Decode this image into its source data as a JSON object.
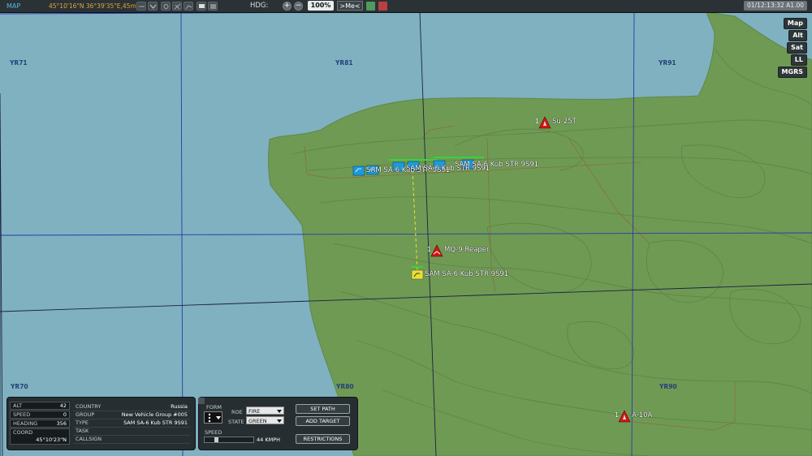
{
  "topbar": {
    "title": "MAP",
    "coordinates": "45°10'16\"N 36°39'35\"E,45m",
    "hdg_label": "HDG:",
    "zoom": "100%",
    "center_me": ">Me<",
    "time": "01/12:13:32 A1.00",
    "zoom_in": "+",
    "zoom_out": "−"
  },
  "map_mode_buttons": [
    "Map",
    "Alt",
    "Sat",
    "LL",
    "MGRS"
  ],
  "grid_labels": [
    "YR71",
    "YR81",
    "YR91",
    "YR70",
    "YR80",
    "YR90"
  ],
  "units": {
    "su25": {
      "count": "1",
      "name": "Su-25T"
    },
    "reaper": {
      "count": "1",
      "name": "MQ-9 Reaper"
    },
    "a10": {
      "count": "1",
      "name": "A-10A"
    },
    "sam_selected": {
      "name": "SAM SA-6 Kub STR 9S91"
    },
    "sam_cluster": {
      "label_a": "SAM SA-6 Kub STR 9S91",
      "label_b": "SAM SA-6 Kub STR 9S91",
      "label_c": "SAM SA-6 Kub STR 9S91"
    }
  },
  "unit_info": {
    "alt_label": "ALT",
    "alt_value": "42",
    "speed_label": "SPEED",
    "speed_value": "0",
    "heading_label": "HEADING",
    "heading_value": "356",
    "coord_label": "COORD",
    "coord_value": "45°10'23\"N"
  },
  "unit_props": {
    "country_label": "COUNTRY",
    "country_value": "Russia",
    "group_label": "GROUP",
    "group_value": "New Vehicle Group #005",
    "type_label": "TYPE",
    "type_value": "SAM SA-6 Kub STR 9S91",
    "task_label": "TASK",
    "task_value": "",
    "callsign_label": "CALLSIGN",
    "callsign_value": ""
  },
  "orders": {
    "form_label": "FORM",
    "roe_label": "ROE",
    "roe_value": "FIRE",
    "state_label": "STATE",
    "state_value": "GREEN",
    "speed_label": "SPEED",
    "speed_value": "44 KMPH",
    "speed_fraction": 0.22,
    "set_path": "SET PATH",
    "add_target": "ADD TARGET",
    "restrictions": "RESTRICTIONS"
  },
  "colors": {
    "sea": "#7fb1c0",
    "land": "#6f9a54",
    "red_coalition": "#d01818",
    "blue_coalition": "#1a9be0",
    "selected": "#e8e030"
  }
}
